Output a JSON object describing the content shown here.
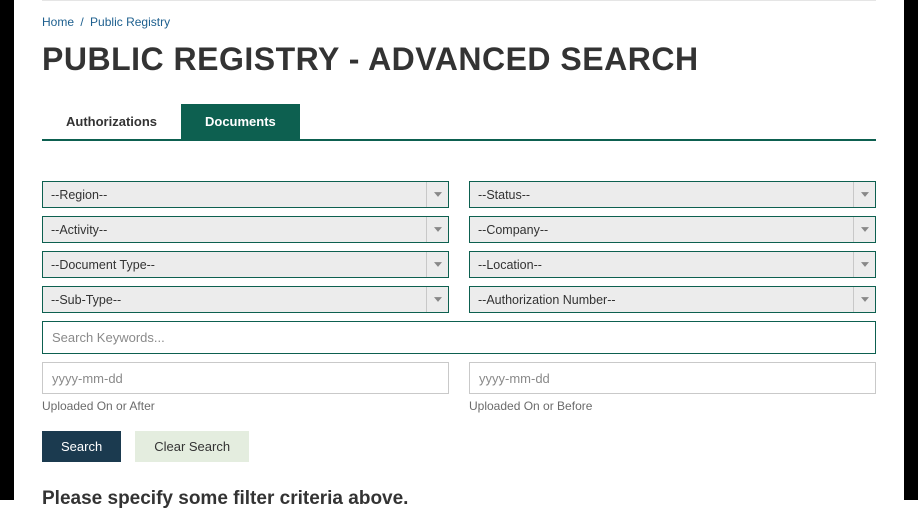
{
  "breadcrumb": {
    "home": "Home",
    "current": "Public Registry"
  },
  "page_title": "PUBLIC REGISTRY - ADVANCED SEARCH",
  "tabs": {
    "authorizations": "Authorizations",
    "documents": "Documents"
  },
  "filters": {
    "region": "--Region--",
    "status": "--Status--",
    "activity": "--Activity--",
    "company": "--Company--",
    "document_type": "--Document Type--",
    "location": "--Location--",
    "sub_type": "--Sub-Type--",
    "authorization_number": "--Authorization Number--"
  },
  "keywords": {
    "placeholder": "Search Keywords..."
  },
  "dates": {
    "placeholder": "yyyy-mm-dd",
    "after_label": "Uploaded On or After",
    "before_label": "Uploaded On or Before"
  },
  "buttons": {
    "search": "Search",
    "clear": "Clear Search"
  },
  "message": "Please specify some filter criteria above."
}
